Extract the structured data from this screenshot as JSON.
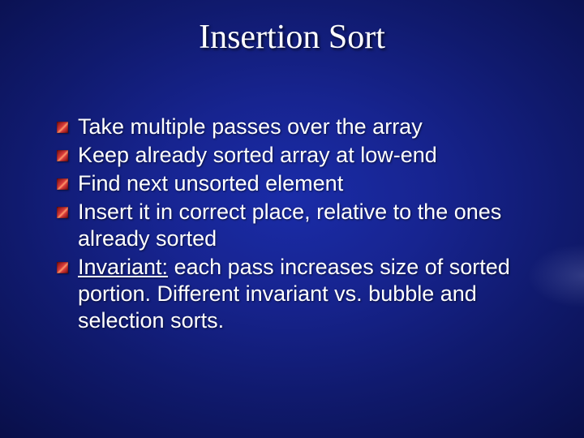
{
  "slide": {
    "title": "Insertion Sort",
    "bullets": [
      {
        "text": "Take multiple passes over the array"
      },
      {
        "text": "Keep already sorted array at low-end"
      },
      {
        "text": "Find next unsorted element"
      },
      {
        "text": "Insert it in correct place, relative to the ones already sorted"
      },
      {
        "label": "Invariant:",
        "text": " each pass increases size of sorted portion. Different invariant vs. bubble and selection sorts."
      }
    ]
  }
}
